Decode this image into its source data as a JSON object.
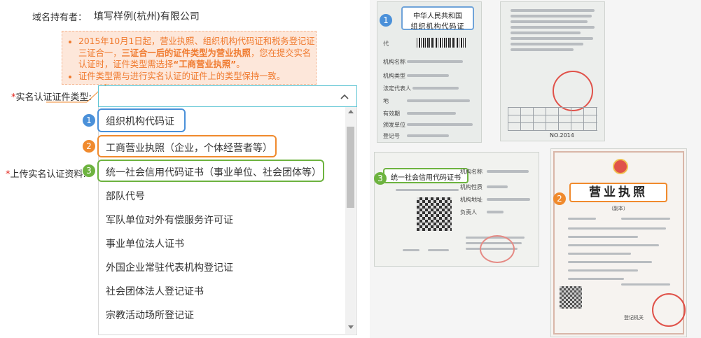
{
  "form": {
    "owner_label": "域名持有者：",
    "owner_value": "填写样例(杭州)有限公司",
    "cert_type_label": "实名认证证件类型:",
    "upload_label": "上传实名认证资料:",
    "required_mark": "*"
  },
  "notice": {
    "line1_a": "2015年10月1日起，营业执照、组织机构代码证和税务登记证三证合一，",
    "line1_bold": "三证合一后的证件类型为营业执照",
    "line1_b": "，您在提交实名认证时，证件类型需选择",
    "line1_c": "“工商营业执照”",
    "line1_d": "。",
    "line2": "证件类型需与进行实名认证的证件上的类型保持一致。"
  },
  "dropdown": {
    "options": [
      "组织机构代码证",
      "工商营业执照（企业，个体经营者等）",
      "统一社会信用代码证书（事业单位、社会团体等）",
      "部队代号",
      "军队单位对外有偿服务许可证",
      "事业单位法人证书",
      "外国企业常驻代表机构登记证",
      "社会团体法人登记证书",
      "宗教活动场所登记证"
    ],
    "badges": [
      "1",
      "2",
      "3"
    ]
  },
  "docs": {
    "org_code_title_1": "中华人民共和国",
    "org_code_title_2": "组织机构代码证",
    "org_code_fields": [
      "代",
      "机构名称",
      "机构类型",
      "法定代表人",
      "地",
      "有效期",
      "颁发单位",
      "登记号"
    ],
    "org_code_back_no": "NO.2014",
    "credit_title": "统一社会信用代码证书",
    "credit_fields": [
      "机构名称",
      "机构性质",
      "机构地址",
      "负责人"
    ],
    "license_title": "营业执照",
    "license_sub": "（副本）",
    "license_footer": "登记机关",
    "badges": [
      "1",
      "2",
      "3"
    ]
  },
  "colors": {
    "blue": "#4a90d9",
    "orange": "#f08a2d",
    "green": "#6db33f",
    "cyan": "#5cc4d3",
    "notice_bg": "#fde7da",
    "notice_text": "#f07a2e"
  }
}
